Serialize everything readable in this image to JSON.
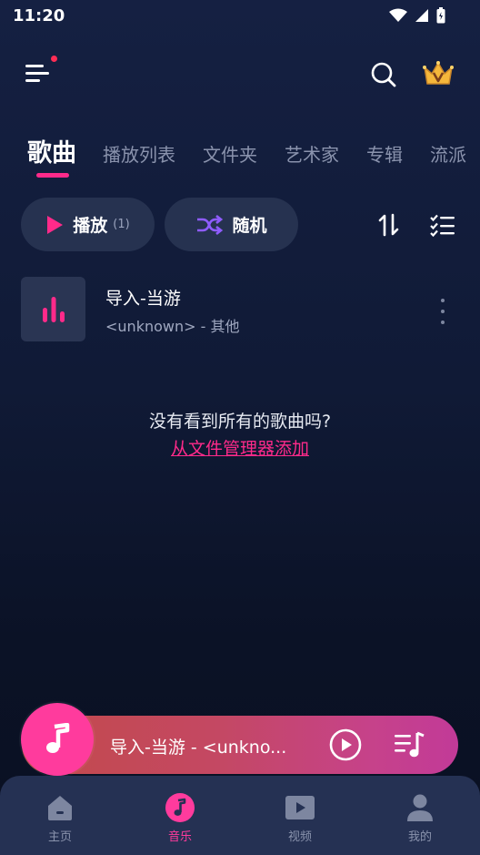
{
  "status_bar": {
    "time": "11:20"
  },
  "header": {
    "menu_icon": "hamburger-menu-icon",
    "search_icon": "search-icon",
    "vip_icon": "crown-vip-icon"
  },
  "tabs": [
    {
      "label": "歌曲",
      "active": true
    },
    {
      "label": "播放列表"
    },
    {
      "label": "文件夹"
    },
    {
      "label": "艺术家"
    },
    {
      "label": "专辑"
    },
    {
      "label": "流派"
    }
  ],
  "actions": {
    "play_label": "播放",
    "play_count": "(1)",
    "shuffle_label": "随机"
  },
  "songs": [
    {
      "title": "导入-当游",
      "subtitle": "<unknown> - 其他"
    }
  ],
  "hint": {
    "text": "没有看到所有的歌曲吗?",
    "link": "从文件管理器添加"
  },
  "mini_player": {
    "title": "导入-当游 - <unkno..."
  },
  "bottom_nav": [
    {
      "label": "主页",
      "icon": "home-icon"
    },
    {
      "label": "音乐",
      "icon": "music-note-icon",
      "active": true
    },
    {
      "label": "视频",
      "icon": "video-play-icon"
    },
    {
      "label": "我的",
      "icon": "profile-icon"
    }
  ],
  "colors": {
    "accent": "#ff2a8a",
    "background": "#101a36",
    "surface": "#263250"
  }
}
